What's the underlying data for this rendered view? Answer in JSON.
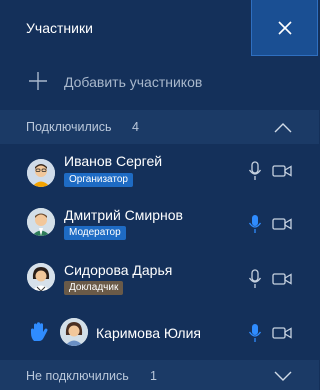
{
  "header": {
    "title": "Участники"
  },
  "add": {
    "label": "Добавить участников"
  },
  "connected": {
    "title": "Подключились",
    "count": "4"
  },
  "participants": [
    {
      "name": "Иванов Сергей",
      "role": "Организатор",
      "role_color": "#1e6bc4",
      "mic_active": false
    },
    {
      "name": "Дмитрий Смирнов",
      "role": "Модератор",
      "role_color": "#1e6bc4",
      "mic_active": true
    },
    {
      "name": "Сидорова Дарья",
      "role": "Докладчик",
      "role_color": "#6a5a48",
      "mic_active": false
    },
    {
      "name": "Каримова Юлия",
      "role": "",
      "role_color": "",
      "mic_active": true,
      "hand_raised": true
    }
  ],
  "disconnected": {
    "title": "Не подключились",
    "count": "1"
  },
  "colors": {
    "background": "#14305a",
    "section_bg": "#1b3a66",
    "close_bg": "#1a4f93",
    "mic_active": "#2f8cff",
    "icon_muted": "#c7d2e0"
  }
}
